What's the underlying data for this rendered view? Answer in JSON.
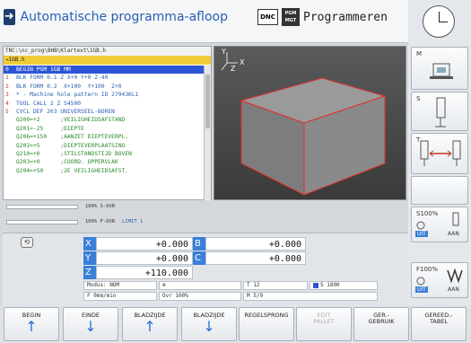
{
  "header": {
    "mode_main": "Automatische programma-afloop",
    "mode_main_icon": "play-arrow-icon",
    "dnc": "DNC",
    "mode_prog": "Programmeren",
    "mode_prog_icon_text": "PGM MGT"
  },
  "program": {
    "path": "TNC:\\nc_prog\\BHB\\Klartext\\1GB.h",
    "file": "→1GB.h",
    "lines": [
      {
        "n": "0",
        "text": "BEGIN PGM 1GB MM",
        "selected": true
      },
      {
        "n": "1",
        "text": "BLK FORM 0.1 Z X+0 Y+0 Z-40"
      },
      {
        "n": "2",
        "text": "BLK FORM 0.2  X+100  Y+100  Z+0"
      },
      {
        "n": "3",
        "text": "* - Machine hole pattern ID 27943KL1"
      },
      {
        "n": "4",
        "text": "TOOL CALL 2 Z S4500"
      },
      {
        "n": "5",
        "text": "CYCL DEF 203 UNIVERSEEL-BOREN"
      },
      {
        "n": "",
        "text": "Q200=+2      ;VEILIGHEIDSAFSTAND",
        "param": true
      },
      {
        "n": "",
        "text": "Q201=-25     ;DIEPTE",
        "param": true
      },
      {
        "n": "",
        "text": "Q206=+150    ;AANZET DIEPTEVERPL.",
        "param": true
      },
      {
        "n": "",
        "text": "Q202=+5      ;DIEPTEVERPLAATSING",
        "param": true
      },
      {
        "n": "",
        "text": "Q210=+0      ;STILSTANDSTIJD BOVEN",
        "param": true
      },
      {
        "n": "",
        "text": "Q203=+0      ;COORD. OPPERVLAK",
        "param": true
      },
      {
        "n": "",
        "text": "Q204=+50     ;2E VEILIGHEIDSAFST.",
        "param": true
      }
    ]
  },
  "overrides": {
    "s": "100% S-OVR",
    "f": "100% F-OVR",
    "limit": "LIMIT 1"
  },
  "positions": {
    "x_label": "X",
    "x_value": "+0.000",
    "y_label": "Y",
    "y_value": "+0.000",
    "z_label": "Z",
    "z_value": "+110.000",
    "b_label": "B",
    "b_value": "+0.000",
    "c_label": "C",
    "c_value": "+0.000"
  },
  "status": {
    "modus": "Modus: NOM",
    "f": "F  0mm/min",
    "t": "T 12",
    "ovr": "Ovr 100%",
    "s": "S 1800",
    "m": "M 5/9",
    "t_icon": "tool-icon"
  },
  "rightbar": {
    "m": "M",
    "s": "S",
    "t": "T",
    "s_override": "S100%",
    "f_override": "F100%",
    "uit": "UIT",
    "aan": "AAN",
    "clock_icon": "clock-icon"
  },
  "softkeys": [
    {
      "label": "BEGIN",
      "arrow": "↑"
    },
    {
      "label": "EINDE",
      "arrow": "↓"
    },
    {
      "label": "BLADZIJDE",
      "arrow": "↑"
    },
    {
      "label": "BLADZIJDE",
      "arrow": "↓"
    },
    {
      "label": "REGELSPRONG",
      "arrow": ""
    },
    {
      "label": "EDIT\nPALLET",
      "arrow": "",
      "disabled": true
    },
    {
      "label": "GER.-\nGEBRUIK",
      "arrow": ""
    },
    {
      "label": "GEREED.-\nTABEL",
      "arrow": ""
    }
  ],
  "colors": {
    "accent": "#2a5fb0",
    "selection": "#2c55d6",
    "axis": "#3a7fd8"
  }
}
